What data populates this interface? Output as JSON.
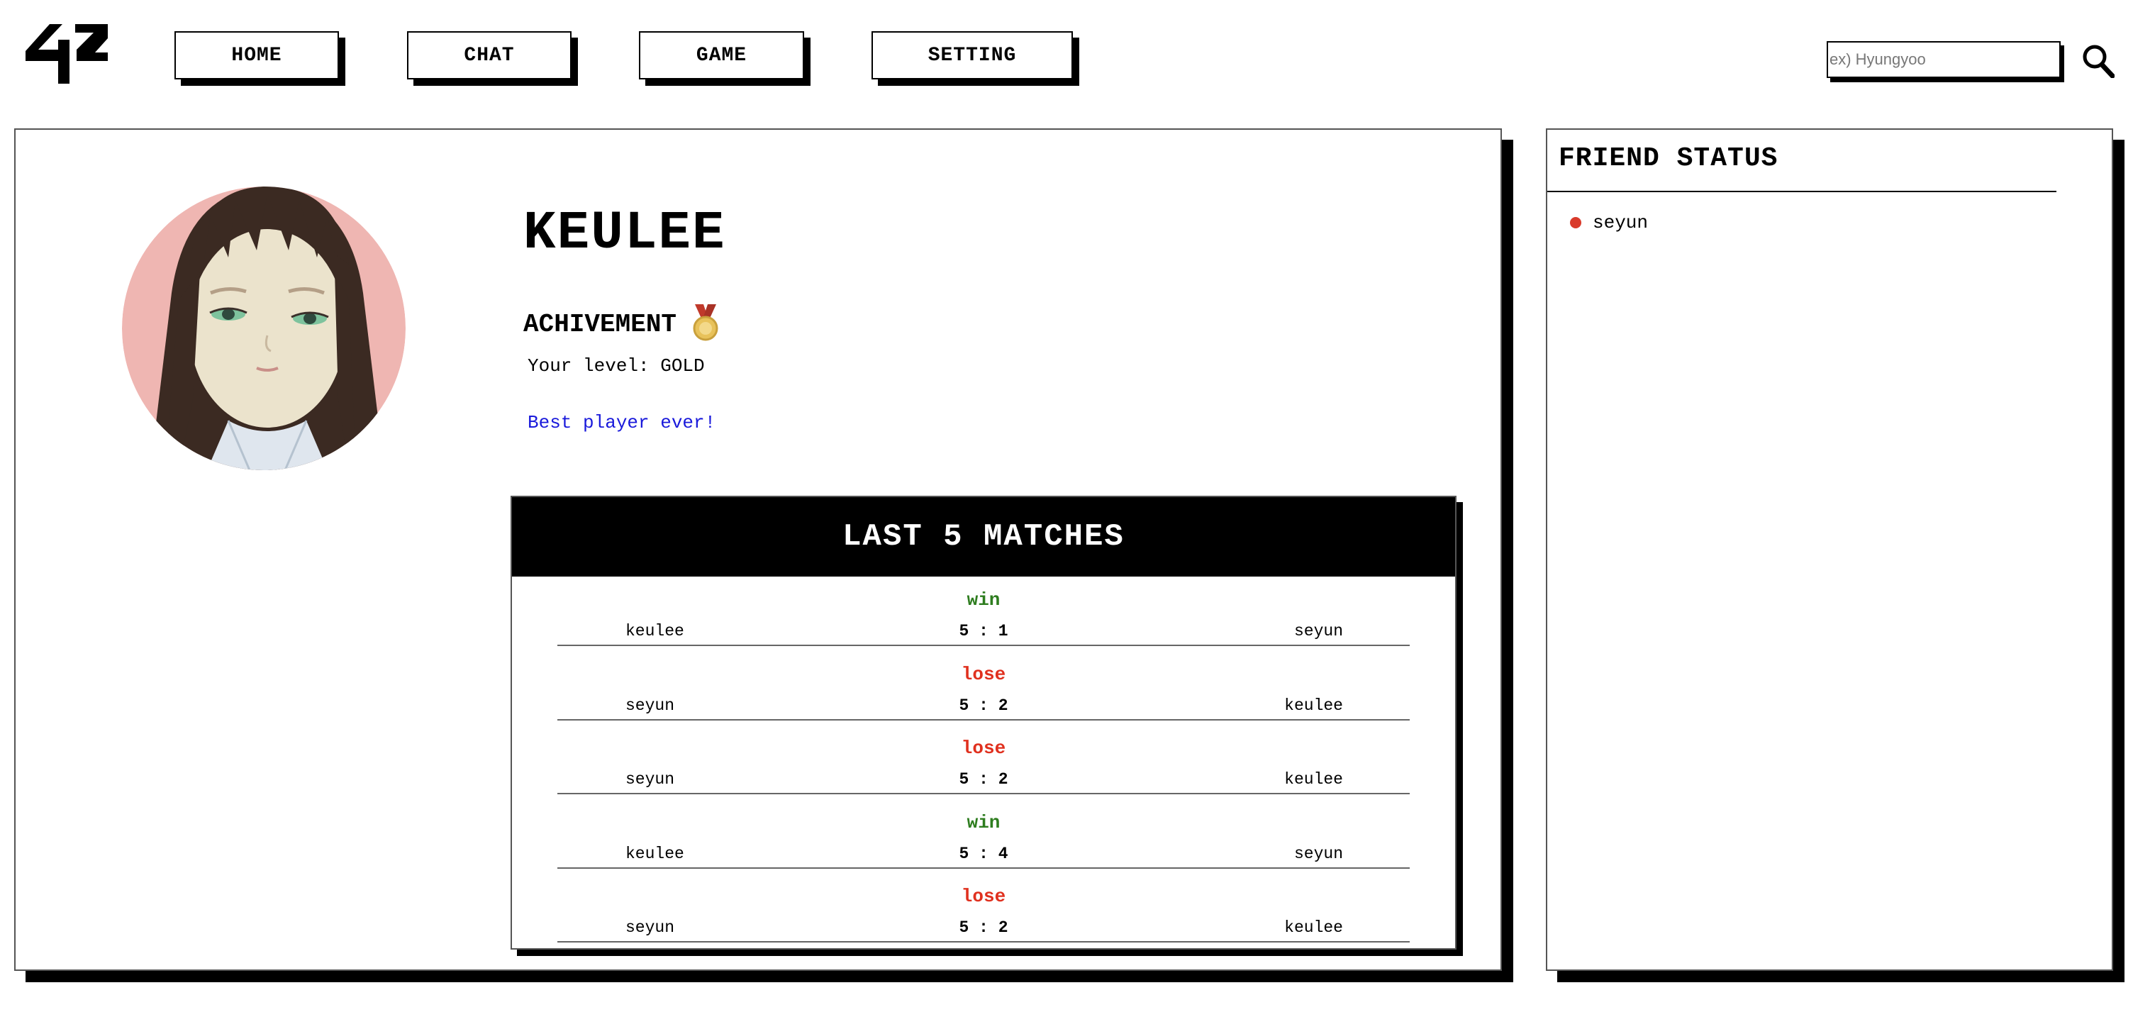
{
  "app": {
    "logo_text": "42"
  },
  "nav": [
    {
      "label": "HOME"
    },
    {
      "label": "CHAT"
    },
    {
      "label": "GAME"
    },
    {
      "label": "SETTING"
    }
  ],
  "search": {
    "placeholder": "ex) Hyungyoo",
    "value": "",
    "icon": "search-icon"
  },
  "profile": {
    "username": "KEULEE",
    "achievement_title": "ACHIVEMENT",
    "achievement_icon": "medal-icon",
    "level_text": "Your level: GOLD",
    "tagline": "Best player ever!",
    "tagline_color": "#1a1adb"
  },
  "matches": {
    "title": "LAST 5 MATCHES",
    "items": [
      {
        "result": "win",
        "left": "keulee",
        "score": "5 : 1",
        "right": "seyun"
      },
      {
        "result": "lose",
        "left": "seyun",
        "score": "5 : 2",
        "right": "keulee"
      },
      {
        "result": "lose",
        "left": "seyun",
        "score": "5 : 2",
        "right": "keulee"
      },
      {
        "result": "win",
        "left": "keulee",
        "score": "5 : 4",
        "right": "seyun"
      },
      {
        "result": "lose",
        "left": "seyun",
        "score": "5 : 2",
        "right": "keulee"
      }
    ],
    "win_color": "#2e7d1f",
    "lose_color": "#e0301e"
  },
  "friends": {
    "title": "FRIEND STATUS",
    "items": [
      {
        "name": "seyun",
        "status_color": "#d93a2b"
      }
    ]
  }
}
